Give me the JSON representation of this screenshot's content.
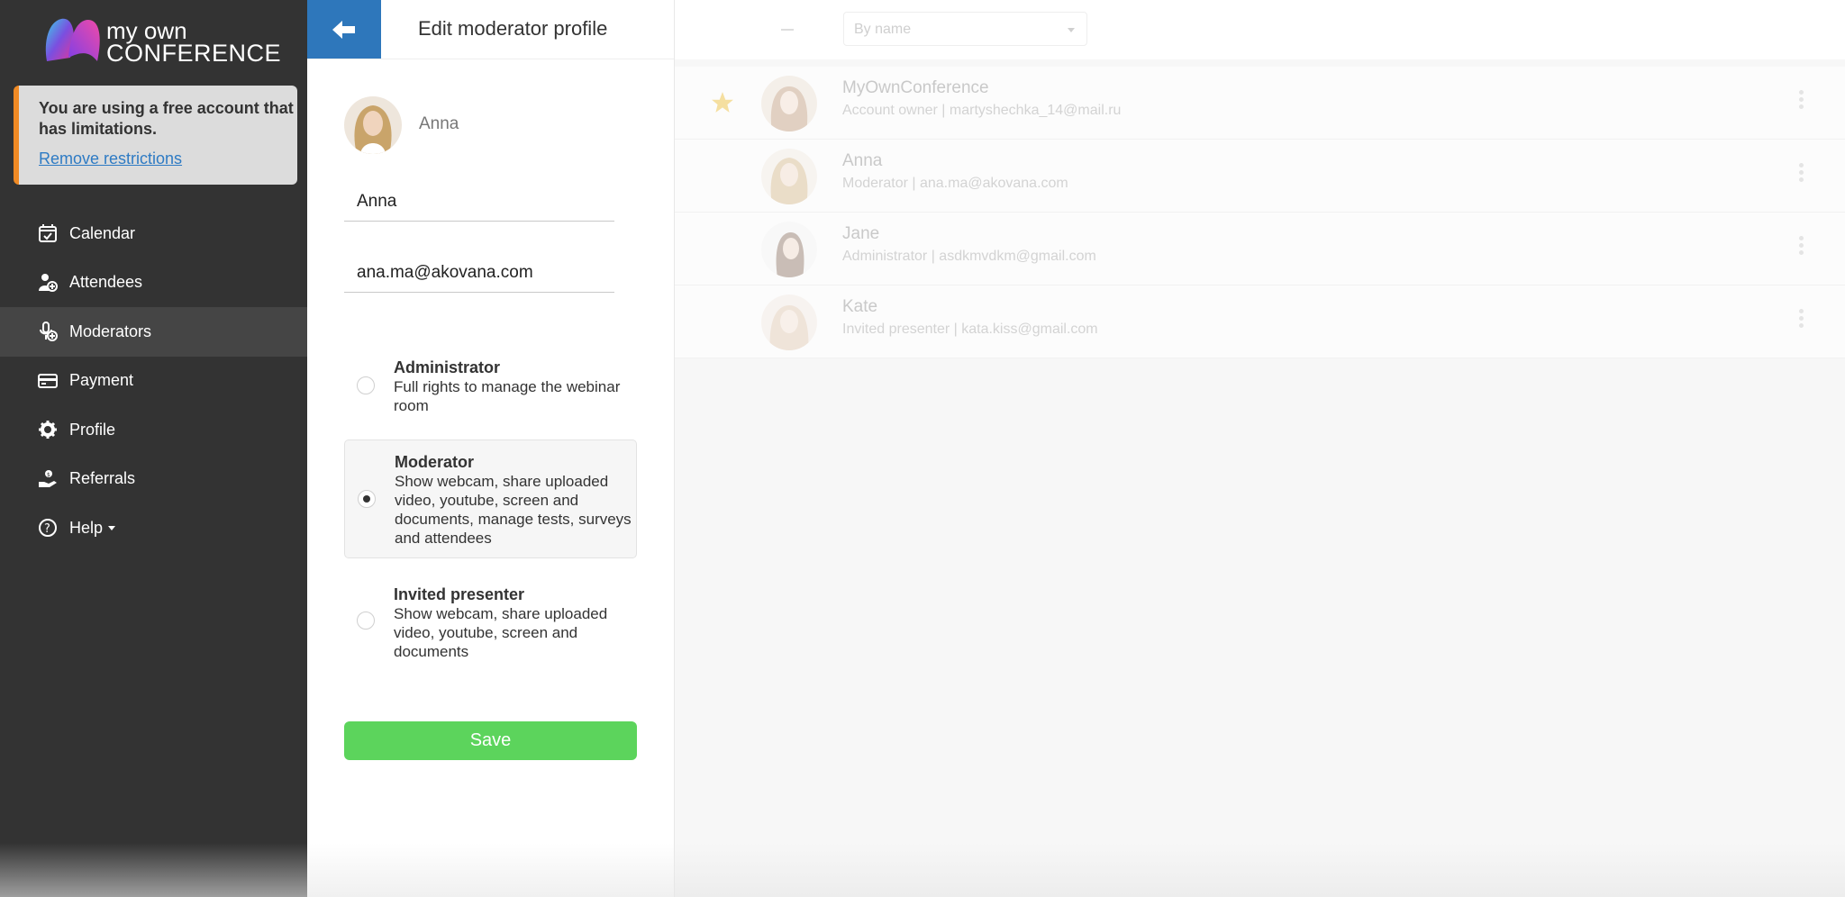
{
  "brand": {
    "line1": "my own",
    "line2": "CONFERENCE"
  },
  "alert": {
    "message": "You are using a free account that has limitations.",
    "link": "Remove restrictions"
  },
  "nav": [
    {
      "label": "Calendar",
      "icon": "calendar-icon"
    },
    {
      "label": "Attendees",
      "icon": "attendees-icon"
    },
    {
      "label": "Moderators",
      "icon": "moderators-icon",
      "active": true
    },
    {
      "label": "Payment",
      "icon": "payment-icon"
    },
    {
      "label": "Profile",
      "icon": "gear-icon"
    },
    {
      "label": "Referrals",
      "icon": "referrals-icon"
    },
    {
      "label": "Help",
      "icon": "help-icon"
    }
  ],
  "edit": {
    "title": "Edit moderator profile",
    "avatar_name": "Anna",
    "name_value": "Anna",
    "email_value": "ana.ma@akovana.com",
    "roles": [
      {
        "title": "Administrator",
        "desc": "Full rights to manage the webinar room",
        "selected": false
      },
      {
        "title": "Moderator",
        "desc": "Show webcam, share uploaded video, youtube, screen and documents, manage tests, surveys and attendees",
        "selected": true
      },
      {
        "title": "Invited presenter",
        "desc": "Show webcam, share uploaded video, youtube, screen and documents",
        "selected": false
      }
    ],
    "save_label": "Save"
  },
  "list": {
    "sort_value": "By name",
    "moderators": [
      {
        "name": "MyOwnConference",
        "sub": "Account owner | martyshechka_14@mail.ru",
        "owner": true
      },
      {
        "name": "Anna",
        "sub": "Moderator | ana.ma@akovana.com"
      },
      {
        "name": "Jane",
        "sub": "Administrator | asdkmvdkm@gmail.com"
      },
      {
        "name": "Kate",
        "sub": "Invited presenter | kata.kiss@gmail.com"
      }
    ]
  },
  "colors": {
    "sidebar": "#333333",
    "accent_blue": "#2e77bb",
    "save_green": "#5cd45c",
    "alert_orange": "#f08a24"
  }
}
